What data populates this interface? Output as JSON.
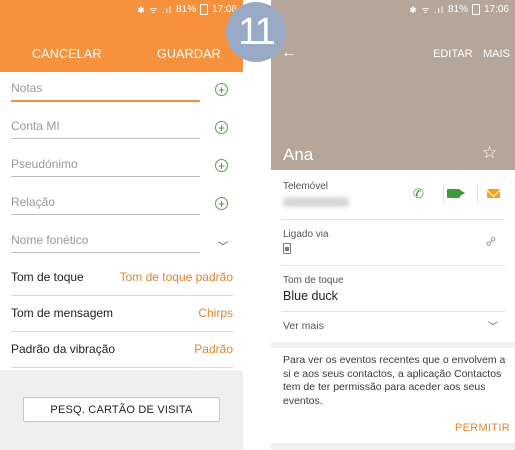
{
  "step_number": "11",
  "status_bar": {
    "battery_percent": "81%",
    "time": "17:06"
  },
  "left_screen": {
    "header": {
      "cancel_label": "CANCELAR",
      "save_label": "GUARDAR",
      "background_color": "#f6913e"
    },
    "fields": [
      {
        "placeholder": "Notas",
        "action_icon": "plus-circle-icon"
      },
      {
        "placeholder": "Conta MI",
        "action_icon": "plus-circle-icon"
      },
      {
        "placeholder": "Pseudónimo",
        "action_icon": "plus-circle-icon"
      },
      {
        "placeholder": "Relação",
        "action_icon": "plus-circle-icon"
      },
      {
        "placeholder": "Nome fonético",
        "action_icon": "chevron-down-icon"
      }
    ],
    "settings": [
      {
        "label": "Tom de toque",
        "value": "Tom de toque padrão"
      },
      {
        "label": "Tom de mensagem",
        "value": "Chirps"
      },
      {
        "label": "Padrão da vibração",
        "value": "Padrão"
      }
    ],
    "card_button_label": "PESQ. CARTÃO DE VISITA"
  },
  "right_screen": {
    "header": {
      "edit_label": "EDITAR",
      "more_label": "MAIS",
      "contact_name": "Ana",
      "background_color": "#b5a699"
    },
    "mobile": {
      "label": "Telemóvel",
      "actions": [
        "phone-icon",
        "video-call-icon",
        "message-icon"
      ]
    },
    "linked_via": {
      "label": "Ligado via",
      "icon": "sim-card-icon"
    },
    "ringtone": {
      "label": "Tom de toque",
      "value": "Blue duck"
    },
    "see_more_label": "Ver mais",
    "permission_notice": "Para ver os eventos recentes que o envolvem a si e aos seus contactos, a aplicação Contactos tem de ter permissão para aceder aos seus eventos.",
    "permit_label": "PERMITIR",
    "accent_color": "#e0862c"
  }
}
